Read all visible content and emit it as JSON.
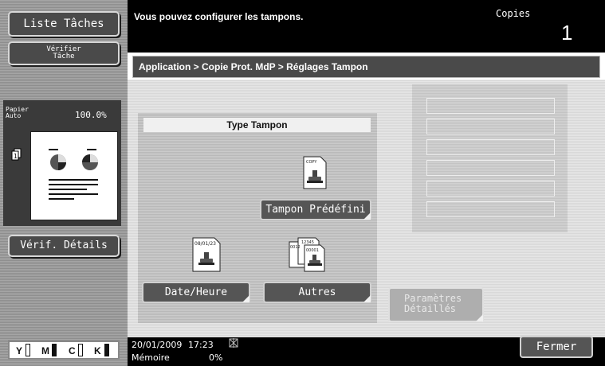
{
  "sidebar": {
    "liste_taches": "Liste Tâches",
    "verifier_tache": [
      "Vérifier",
      "Tâche"
    ],
    "papier_label": [
      "Papier",
      "Auto"
    ],
    "papier_zoom": "100.0%",
    "verif_details": "Vérif. Détails",
    "toner": [
      {
        "letter": "Y",
        "color": "#111111"
      },
      {
        "letter": "M",
        "color": "#111111"
      },
      {
        "letter": "C",
        "color": "#111111"
      },
      {
        "letter": "K",
        "color": "#111111"
      }
    ]
  },
  "header": {
    "message": "Vous pouvez configurer les tampons.",
    "copies_label": "Copies",
    "copies_count": "1"
  },
  "breadcrumb": "Application > Copie Prot. MdP > Réglages Tampon",
  "type_tampon": {
    "title": "Type Tampon",
    "buttons": {
      "predefini": "Tampon Prédéfini",
      "date_heure": "Date/Heure",
      "autres": "Autres"
    },
    "icons": {
      "predefini": "copy-stamp-icon",
      "date_heure": "date-stamp-icon",
      "autres": "numbering-stamp-icon"
    },
    "icon_text": {
      "copy": "COPY",
      "date": "08/01/23",
      "autres_a": "12345",
      "autres_b": "0012",
      "autres_c": "00001"
    }
  },
  "settings_slots_count": 6,
  "parametres_detailles": [
    "Paramètres",
    "Détaillés"
  ],
  "status": {
    "date": "20/01/2009",
    "time": "17:23",
    "memory_label": "Mémoire",
    "memory_value": "0%",
    "status_icon": "network-icon"
  },
  "fermer": "Fermer"
}
